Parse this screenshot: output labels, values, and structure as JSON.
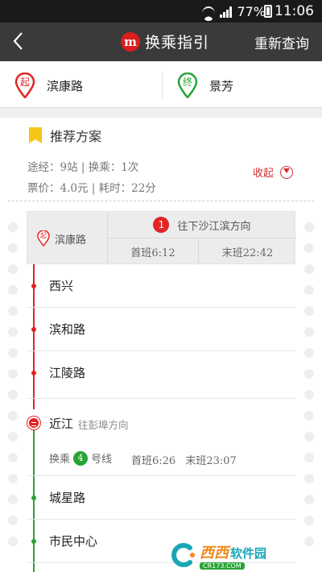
{
  "status_bar": {
    "battery": "77%",
    "time": "11:06"
  },
  "nav": {
    "logo_letter": "m",
    "title": "换乘指引",
    "requery": "重新查询"
  },
  "stations": {
    "start": {
      "marker": "起",
      "name": "滨康路"
    },
    "end": {
      "marker": "终",
      "name": "景芳"
    }
  },
  "plan": {
    "title": "推荐方案",
    "info_line1": "途经：9站 | 换乘：1次",
    "info_line2": "票价：4.0元 | 耗时：22分",
    "collapse": "收起"
  },
  "route": {
    "start_marker": "起",
    "start_name": "滨康路",
    "line1": {
      "number": "1",
      "direction": "往下沙江滨方向",
      "first": "首班6:12",
      "last": "末班22:42"
    },
    "stops_line1": [
      "西兴",
      "滨和路",
      "江陵路"
    ],
    "transfer": {
      "station": "近江",
      "direction": "往彭埠方向",
      "label": "换乘",
      "line_number": "4",
      "line_suffix": "号线",
      "first": "首班6:26",
      "last": "末班23:07"
    },
    "stops_line4": [
      "城星路",
      "市民中心"
    ]
  },
  "watermark": {
    "main_a": "西西",
    "main_b": "软件园",
    "sub": "CR173.COM"
  },
  "colors": {
    "line1": "#e02424",
    "line4": "#27a534",
    "navbar": "#3a3a3a",
    "accent": "#d32f2f"
  }
}
